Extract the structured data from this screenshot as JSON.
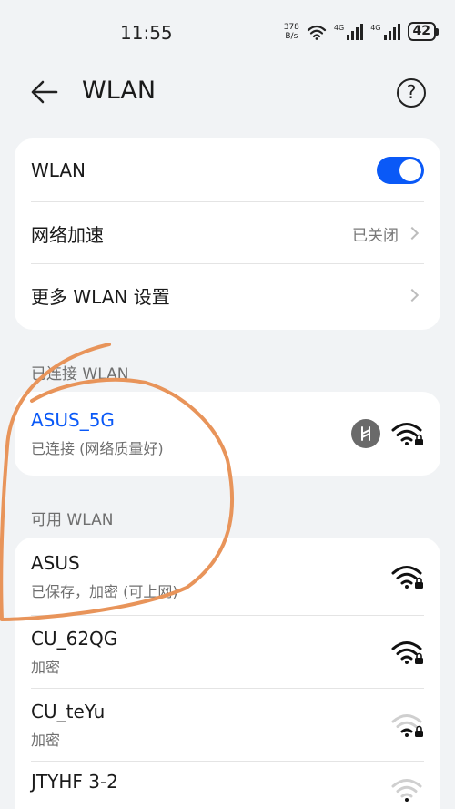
{
  "status_bar": {
    "time": "11:55",
    "net_speed_value": "378",
    "net_speed_unit": "B/s",
    "signal_label_1": "4G",
    "signal_label_2": "4G",
    "battery": "42"
  },
  "header": {
    "title": "WLAN",
    "back_icon": "arrow-left-icon",
    "help_icon": "question-icon",
    "help_glyph": "?"
  },
  "settings": {
    "wlan_label": "WLAN",
    "wlan_enabled": true,
    "network_boost_label": "网络加速",
    "network_boost_value": "已关闭",
    "more_settings_label": "更多 WLAN 设置"
  },
  "connected_section": {
    "label": "已连接 WLAN",
    "network": {
      "name": "ASUS_5G",
      "status": "已连接 (网络质量好)"
    }
  },
  "available_section": {
    "label": "可用 WLAN",
    "networks": [
      {
        "name": "ASUS",
        "status": "已保存，加密 (可上网)",
        "signal": "strong"
      },
      {
        "name": "CU_62QG",
        "status": "加密",
        "signal": "strong"
      },
      {
        "name": "CU_teYu",
        "status": "加密",
        "signal": "weak"
      },
      {
        "name": "JTYHF 3-2",
        "status": "",
        "signal": "weak"
      }
    ]
  },
  "colors": {
    "accent": "#0a59f7",
    "annotation": "#e8945a",
    "background": "#f1f3f5"
  }
}
